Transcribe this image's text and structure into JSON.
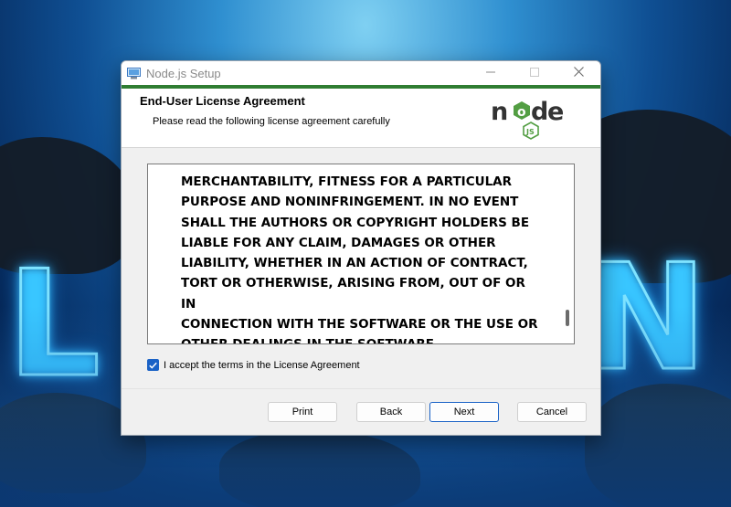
{
  "window": {
    "title": "Node.js Setup",
    "controls": {
      "minimize_icon": "minimize-icon",
      "maximize_icon": "maximize-icon",
      "close_icon": "close-icon"
    }
  },
  "header": {
    "title": "End-User License Agreement",
    "subtitle": "Please read the following license agreement carefully",
    "logo": {
      "word": "node",
      "badge": "JS"
    }
  },
  "license": {
    "text": "MERCHANTABILITY, FITNESS FOR A PARTICULAR\nPURPOSE AND NONINFRINGEMENT. IN NO EVENT\nSHALL THE AUTHORS OR COPYRIGHT HOLDERS BE\nLIABLE FOR ANY CLAIM, DAMAGES OR OTHER\nLIABILITY, WHETHER IN AN ACTION OF CONTRACT,\nTORT OR OTHERWISE, ARISING FROM, OUT OF OR IN\nCONNECTION WITH THE SOFTWARE OR THE USE OR\nOTHER DEALINGS IN THE SOFTWARE."
  },
  "accept": {
    "label": "I accept the terms in the License Agreement",
    "checked": true
  },
  "buttons": {
    "print": "Print",
    "back": "Back",
    "next": "Next",
    "cancel": "Cancel"
  },
  "colors": {
    "accent": "#1a62c6",
    "header_bar": "#2f7d32",
    "node_green": "#539e43",
    "node_dark": "#333333"
  },
  "desktop": {
    "wallpaper_letters": [
      "L",
      "N"
    ]
  }
}
